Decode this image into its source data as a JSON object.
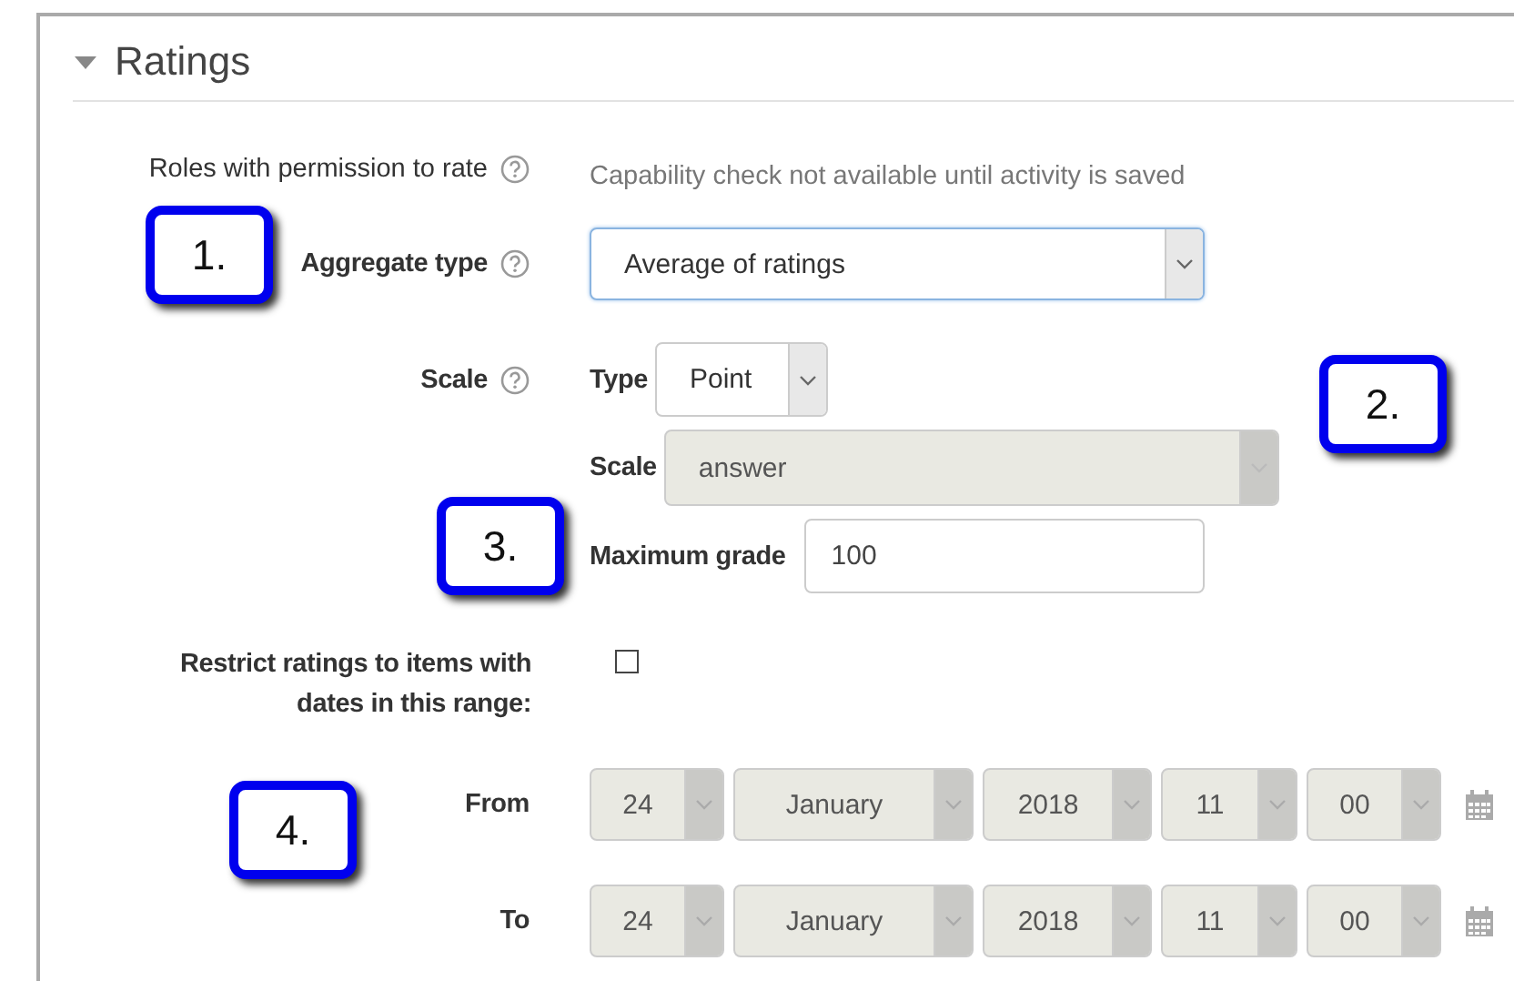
{
  "section": {
    "title": "Ratings",
    "expanded": true
  },
  "rows": [
    {
      "kind": "info",
      "label": "Roles with permission to rate",
      "help": true,
      "value": "Capability check not available until activity is saved"
    },
    {
      "kind": "select",
      "label": "Aggregate type",
      "help": true,
      "value": "Average of ratings",
      "focused": true
    },
    {
      "kind": "group",
      "label": "Scale",
      "help": true,
      "parts": [
        {
          "kind": "select",
          "label": "Type",
          "value": "Point",
          "disabled": false
        },
        {
          "kind": "select",
          "label": "Scale",
          "value": "answer",
          "disabled": true
        },
        {
          "kind": "input",
          "label": "Maximum grade",
          "value": "100"
        }
      ]
    },
    {
      "kind": "checkbox",
      "label": "Restrict ratings to items with dates in this range:",
      "help": false,
      "checked": false
    },
    {
      "kind": "date",
      "label": "From",
      "help": false,
      "parts": [
        {
          "value": "24",
          "disabled": true
        },
        {
          "value": "January",
          "disabled": true
        },
        {
          "value": "2018",
          "disabled": true
        },
        {
          "value": "11",
          "disabled": true
        },
        {
          "value": "00",
          "disabled": true
        }
      ]
    },
    {
      "kind": "date",
      "label": "To",
      "help": false,
      "parts": [
        {
          "value": "24",
          "disabled": true
        },
        {
          "value": "January",
          "disabled": true
        },
        {
          "value": "2018",
          "disabled": true
        },
        {
          "value": "11",
          "disabled": true
        },
        {
          "value": "00",
          "disabled": true
        }
      ]
    }
  ],
  "callouts": [
    {
      "label": "1."
    },
    {
      "label": "2."
    },
    {
      "label": "3."
    },
    {
      "label": "4."
    }
  ]
}
